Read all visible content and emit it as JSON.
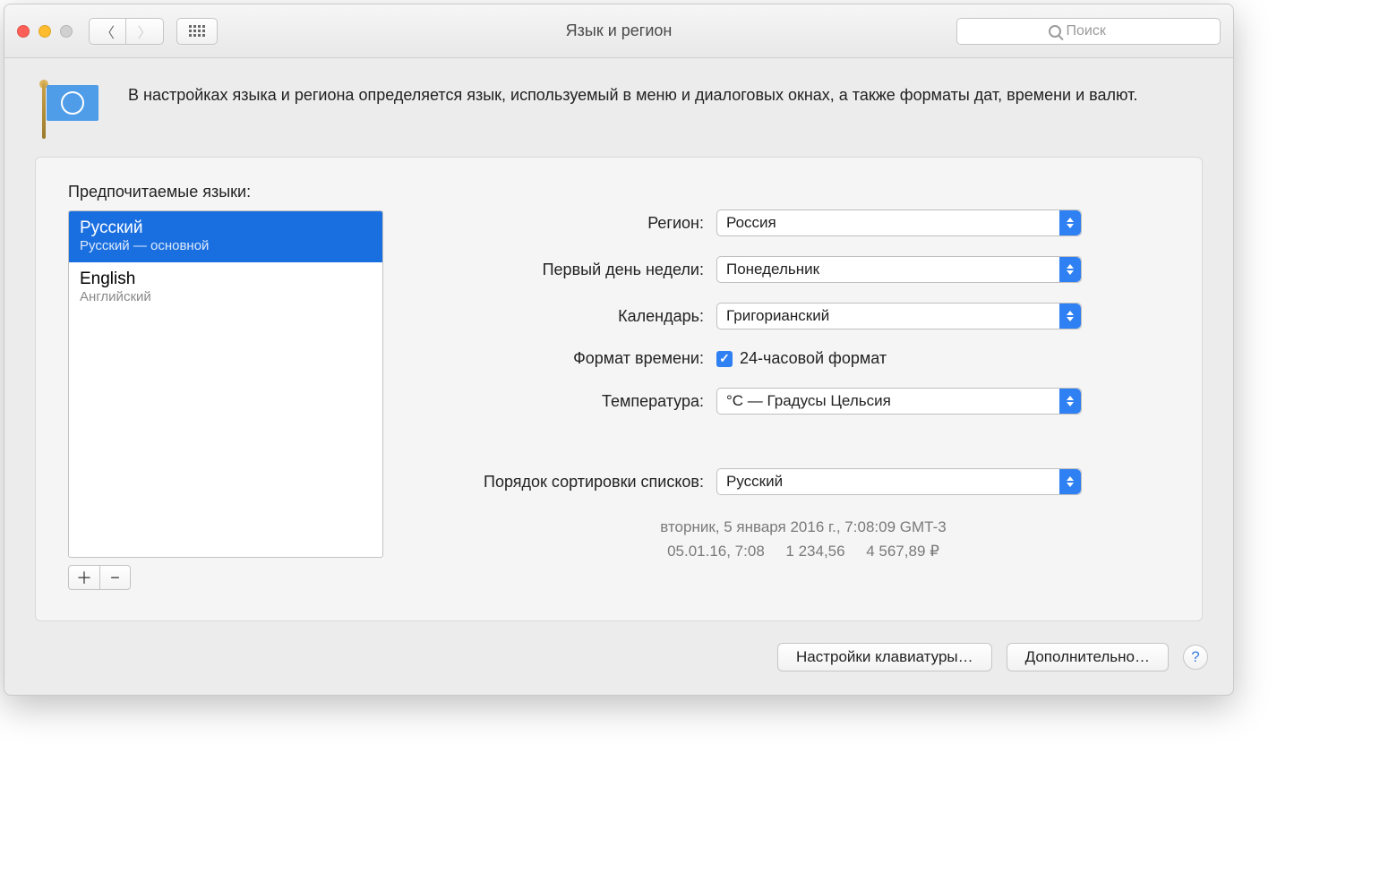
{
  "window": {
    "title": "Язык и регион"
  },
  "search": {
    "placeholder": "Поиск"
  },
  "description": "В настройках языка и региона определяется язык, используемый в меню и диалоговых окнах, а также форматы дат, времени и валют.",
  "preferred_heading": "Предпочитаемые языки:",
  "languages": [
    {
      "name": "Русский",
      "sub": "Русский — основной",
      "selected": true
    },
    {
      "name": "English",
      "sub": "Английский",
      "selected": false
    }
  ],
  "form": {
    "region_label": "Регион:",
    "region_value": "Россия",
    "firstday_label": "Первый день недели:",
    "firstday_value": "Понедельник",
    "calendar_label": "Календарь:",
    "calendar_value": "Григорианский",
    "timefmt_label": "Формат времени:",
    "timefmt_check_label": "24-часовой формат",
    "timefmt_checked": true,
    "temperature_label": "Температура:",
    "temperature_value": "°C — Градусы Цельсия",
    "sort_label": "Порядок сортировки списков:",
    "sort_value": "Русский"
  },
  "examples": {
    "line1": "вторник, 5 января 2016 г., 7:08:09 GMT-3",
    "line2_a": "05.01.16, 7:08",
    "line2_b": "1 234,56",
    "line2_c": "4 567,89 ₽"
  },
  "footer": {
    "keyboard": "Настройки клавиатуры…",
    "advanced": "Дополнительно…"
  }
}
